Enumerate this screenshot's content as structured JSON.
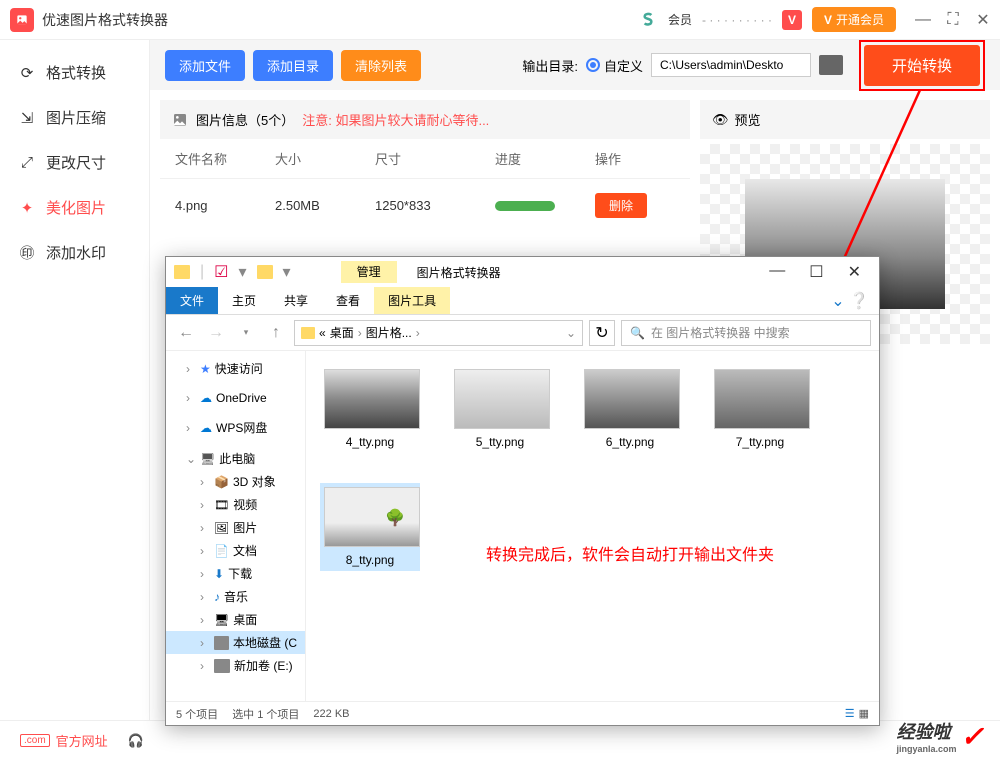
{
  "app": {
    "title": "优速图片格式转换器",
    "user_prefix": "会员",
    "vip_button": "开通会员"
  },
  "sidebar": {
    "items": [
      {
        "label": "格式转换"
      },
      {
        "label": "图片压缩"
      },
      {
        "label": "更改尺寸"
      },
      {
        "label": "美化图片"
      },
      {
        "label": "添加水印"
      }
    ]
  },
  "toolbar": {
    "add_file": "添加文件",
    "add_dir": "添加目录",
    "clear_list": "清除列表",
    "output_label": "输出目录:",
    "custom_label": "自定义",
    "path_value": "C:\\Users\\admin\\Deskto",
    "start_button": "开始转换"
  },
  "panel": {
    "info_label": "图片信息（5个）",
    "notice": "注意: 如果图片较大请耐心等待...",
    "preview_label": "预览",
    "headers": {
      "name": "文件名称",
      "size": "大小",
      "dim": "尺寸",
      "prog": "进度",
      "op": "操作"
    },
    "rows": [
      {
        "name": "4.png",
        "size": "2.50MB",
        "dim": "1250*833",
        "op": "删除"
      }
    ]
  },
  "explorer": {
    "manage_tab": "管理",
    "title": "图片格式转换器",
    "ribbon": {
      "file": "文件",
      "home": "主页",
      "share": "共享",
      "view": "查看",
      "pictools": "图片工具"
    },
    "breadcrumb": {
      "p1": "桌面",
      "p2": "图片格...",
      "lead": "«"
    },
    "search_placeholder": "在 图片格式转换器 中搜索",
    "tree": {
      "quick": "快速访问",
      "onedrive": "OneDrive",
      "wps": "WPS网盘",
      "thispc": "此电脑",
      "obj3d": "3D 对象",
      "video": "视频",
      "pictures": "图片",
      "docs": "文档",
      "downloads": "下载",
      "music": "音乐",
      "desktop": "桌面",
      "diskC": "本地磁盘 (C",
      "diskE": "新加卷 (E:)"
    },
    "files": [
      {
        "name": "4_tty.png"
      },
      {
        "name": "5_tty.png"
      },
      {
        "name": "6_tty.png"
      },
      {
        "name": "7_tty.png"
      },
      {
        "name": "8_tty.png"
      }
    ],
    "message": "转换完成后，软件会自动打开输出文件夹",
    "status": {
      "count": "5 个项目",
      "selected": "选中 1 个项目",
      "size": "222 KB"
    }
  },
  "footer": {
    "official": "官方网址"
  },
  "watermark": {
    "main": "经验啦",
    "sub": "jingyanla.com"
  }
}
